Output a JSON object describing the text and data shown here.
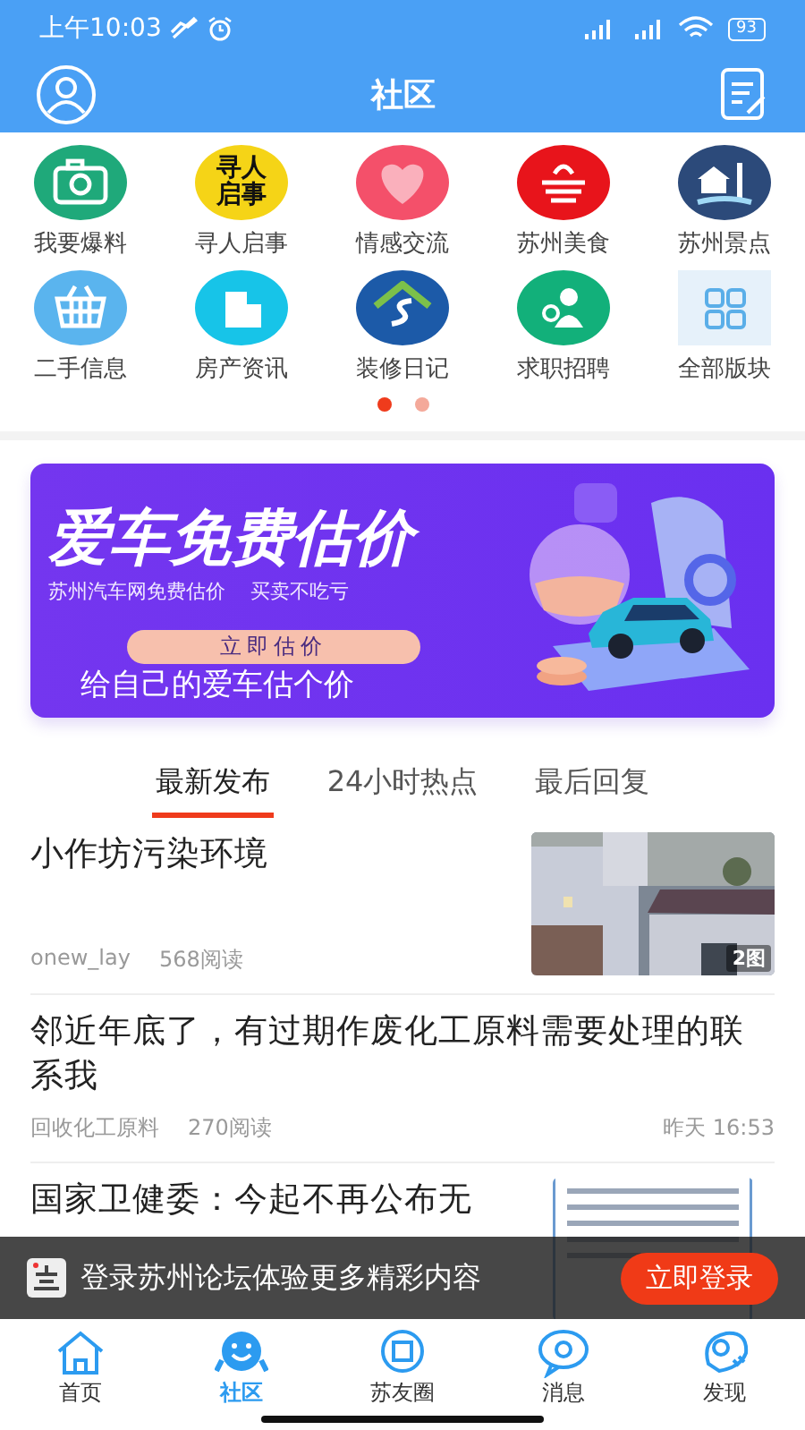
{
  "status_bar": {
    "time": "上午10:03",
    "battery": "93"
  },
  "header": {
    "title": "社区"
  },
  "categories": [
    {
      "label": "我要爆料",
      "color": "#1fa97a"
    },
    {
      "label": "寻人启事",
      "color": "#f5d417",
      "icon_text": [
        "寻人",
        "启事"
      ]
    },
    {
      "label": "情感交流",
      "color": "#f4506a"
    },
    {
      "label": "苏州美食",
      "color": "#e8141b"
    },
    {
      "label": "苏州景点",
      "color": "#2c4a7a"
    },
    {
      "label": "二手信息",
      "color": "#5ab4ee"
    },
    {
      "label": "房产资讯",
      "color": "#17c4e8"
    },
    {
      "label": "装修日记",
      "color": "#1c5aa8"
    },
    {
      "label": "求职招聘",
      "color": "#12b07a"
    },
    {
      "label": "全部版块",
      "color": "#e6f1fa"
    }
  ],
  "pager": [
    {
      "selected": true
    },
    {
      "selected": false
    }
  ],
  "banner": {
    "title": "爱车免费估价",
    "subtitle": "苏州汽车网免费估价",
    "slogan": "买卖不吃亏",
    "button": "立即估价",
    "caption": "给自己的爱车估个价"
  },
  "feed_tabs": [
    {
      "label": "最新发布",
      "selected": true
    },
    {
      "label": "24小时热点",
      "selected": false
    },
    {
      "label": "最后回复",
      "selected": false
    }
  ],
  "posts": [
    {
      "title": "小作坊污染环境",
      "author": "onew_lay",
      "reads": "568阅读",
      "thumbnail": {
        "badge": "2图"
      }
    },
    {
      "title": "邻近年底了，有过期作废化工原料需要处理的联系我",
      "author": "回收化工原料",
      "reads": "270阅读",
      "time": "昨天 16:53"
    },
    {
      "title": "国家卫健委：今起不再公布无",
      "thumbnail": {
        "kind": "document"
      }
    }
  ],
  "login_bar": {
    "text": "登录苏州论坛体验更多精彩内容",
    "button": "立即登录"
  },
  "tab_bar": [
    {
      "label": "首页",
      "selected": false
    },
    {
      "label": "社区",
      "selected": true
    },
    {
      "label": "苏友圈",
      "selected": false
    },
    {
      "label": "消息",
      "selected": false
    },
    {
      "label": "发现",
      "selected": false
    }
  ]
}
